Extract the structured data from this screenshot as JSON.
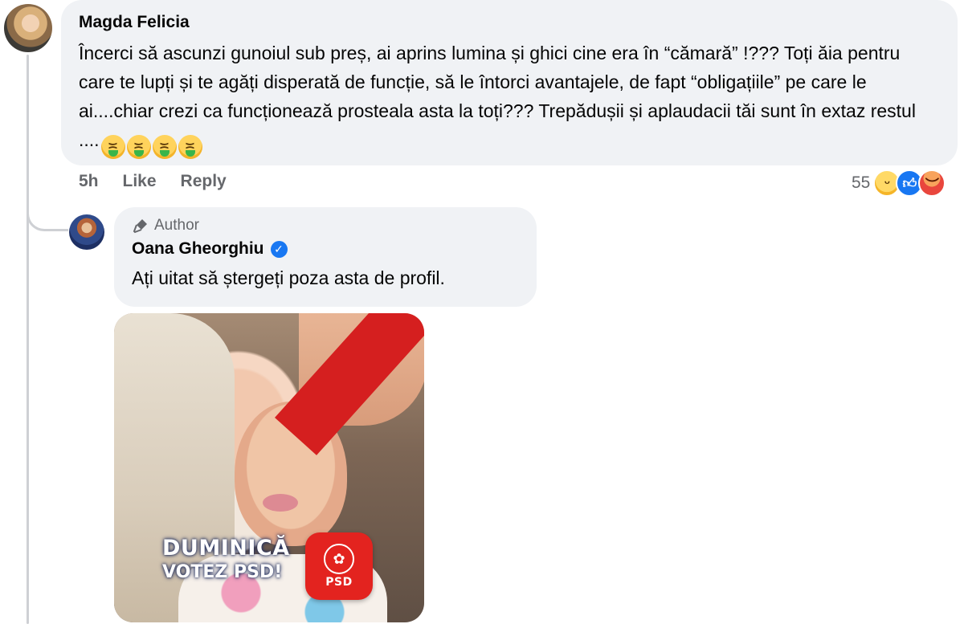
{
  "comment": {
    "author": "Magda Felicia",
    "text": "Încerci să ascunzi gunoiul sub preș, ai aprins lumina și ghici cine era în “cămară” !??? Toți ăia pentru care te lupți și te agăți disperată de funcție, să le întorci avantajele, de fapt “obligațiile” pe care le ai....chiar crezi ca funcționează prosteala asta la toți??? Trepădușii și aplaudacii tăi sunt în extaz restul ....",
    "emojis": [
      "vomiting-face-icon",
      "vomiting-face-icon",
      "vomiting-face-icon",
      "vomiting-face-icon"
    ],
    "time": "5h",
    "like_label": "Like",
    "reply_label": "Reply",
    "reaction_count": "55",
    "reactions": [
      "haha-icon",
      "like-icon",
      "angry-icon"
    ]
  },
  "reply": {
    "badge": "Author",
    "author": "Oana Gheorghiu",
    "verified": true,
    "text": "Ați uitat să ștergeți poza asta de profil.",
    "image": {
      "banner_line1": "DUMINICĂ",
      "banner_line2": "VOTEZ PSD!",
      "logo_text": "PSD",
      "brand_color": "#e3231f"
    }
  },
  "colors": {
    "bubble": "#f0f2f5",
    "meta_text": "#65676b",
    "verified": "#1877f2"
  }
}
